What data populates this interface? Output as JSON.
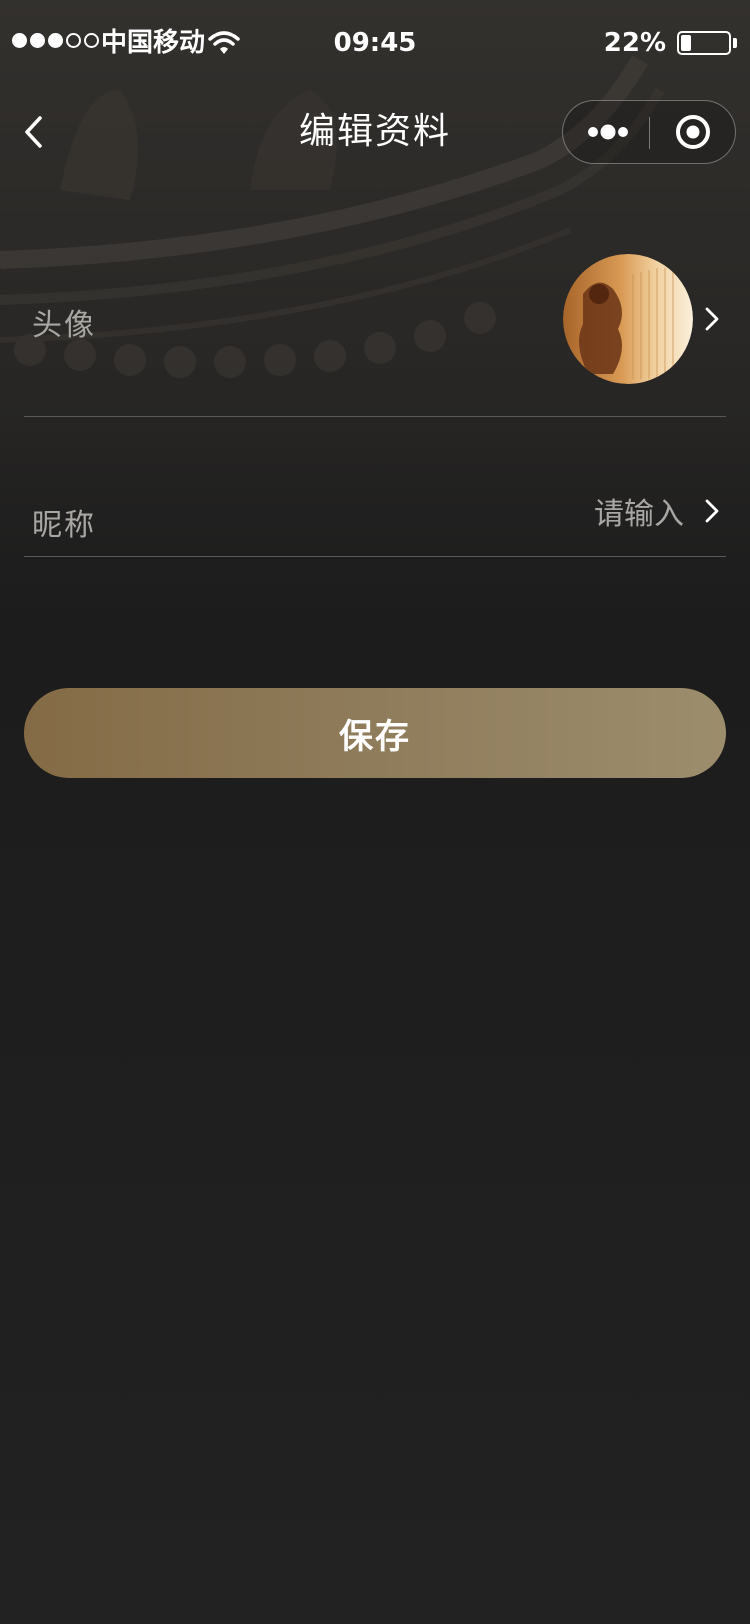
{
  "status_bar": {
    "carrier": "中国移动",
    "time": "09:45",
    "battery_percent": "22%",
    "battery_level": 0.22,
    "signal_strength": 3,
    "signal_total": 5
  },
  "nav": {
    "title": "编辑资料",
    "back_icon": "chevron-left-icon",
    "more_icon": "more-dots-icon",
    "close_icon": "target-circle-icon"
  },
  "form": {
    "avatar_label": "头像",
    "nickname_label": "昵称",
    "nickname_value": "",
    "nickname_placeholder": "请输入"
  },
  "save_button": {
    "label": "保存"
  },
  "colors": {
    "background": "#222222",
    "button_gradient_start": "#846b45",
    "button_gradient_end": "#9c8d6d",
    "label_text": "#a9a7a4",
    "divider": "#5a5856"
  }
}
